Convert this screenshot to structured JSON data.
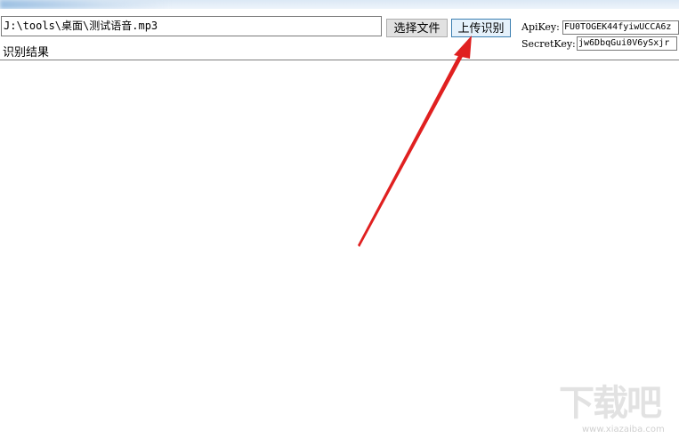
{
  "toolbar": {
    "file_path": "J:\\tools\\桌面\\测试语音.mp3",
    "select_file_label": "选择文件",
    "upload_recognize_label": "上传识别",
    "api_key_label": "ApiKey:",
    "api_key_value": "FU0TOGEK44fyiwUCCA6z",
    "secret_key_label": "SecretKey:",
    "secret_key_value": "jw6DbqGui0V6ySxjr"
  },
  "result": {
    "label": "识别结果",
    "text": ""
  },
  "watermark": {
    "text_cn": "下载吧",
    "url": "www.xiazaiba.com"
  },
  "colors": {
    "arrow": "#e02020",
    "upload_button_border": "#3c7fb1"
  },
  "icons": {
    "annotation": "red-arrow-icon"
  }
}
